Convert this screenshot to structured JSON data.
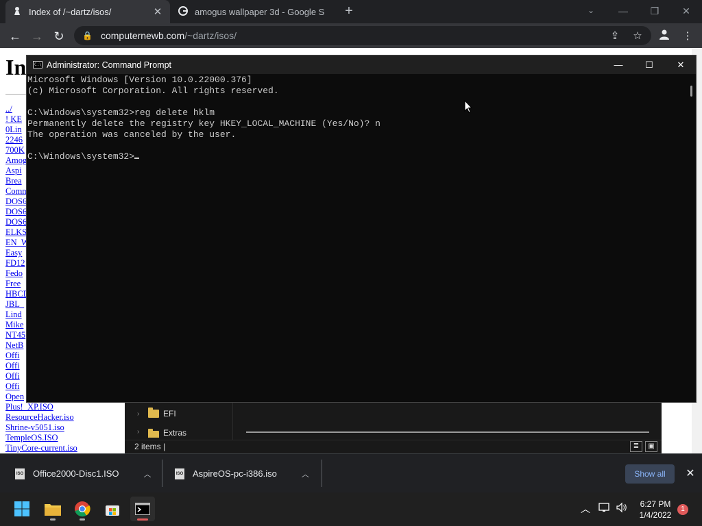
{
  "browser": {
    "tabs": [
      {
        "title": "Index of /~dartz/isos/",
        "icon": "pawn-icon"
      },
      {
        "title": "amogus wallpaper 3d - Google S",
        "icon": "google-icon"
      }
    ],
    "url_host": "computernewb.com",
    "url_path": "/~dartz/isos/"
  },
  "page": {
    "heading": "In",
    "files": [
      "../",
      "! KE",
      "0Lin",
      "2246",
      "700K",
      "Amog",
      "Aspi",
      "Brea",
      "Comm",
      "DOS6",
      "DOS6",
      "DOS6",
      "ELKS",
      "EN_W",
      "Easy",
      "FD12",
      "Fedo",
      "Free",
      "HBCD",
      "JBL_",
      "Lind",
      "Mike",
      "NT45",
      "NetB",
      "Offi",
      "Offi",
      "Offi",
      "Offi",
      "Open",
      "Plus!_XP.ISO",
      "ResourceHacker.iso",
      "Shrine-v5051.iso",
      "TempleOS.ISO",
      "TinyCore-current.iso"
    ]
  },
  "explorer": {
    "tree": [
      {
        "label": "EFI"
      },
      {
        "label": "Extras"
      }
    ],
    "status": "2 items  |"
  },
  "cmd": {
    "title": "Administrator: Command Prompt",
    "lines": [
      "Microsoft Windows [Version 10.0.22000.376]",
      "(c) Microsoft Corporation. All rights reserved.",
      "",
      "C:\\Windows\\system32>reg delete hklm",
      "Permanently delete the registry key HKEY_LOCAL_MACHINE (Yes/No)? n",
      "The operation was canceled by the user.",
      "",
      "C:\\Windows\\system32>"
    ]
  },
  "downloads": {
    "items": [
      {
        "name": "Office2000-Disc1.ISO",
        "icon_text": "ISO"
      },
      {
        "name": "AspireOS-pc-i386.iso",
        "icon_text": "ISO"
      }
    ],
    "show_all": "Show all"
  },
  "taskbar": {
    "time": "6:27 PM",
    "date": "1/4/2022",
    "notifications": "1"
  },
  "colors": {
    "chrome_dark": "#202124",
    "chrome_toolbar": "#35363a",
    "cmd_bg": "#0c0c0c",
    "link": "#0000ee",
    "accent_blue": "#8ab4f8"
  }
}
